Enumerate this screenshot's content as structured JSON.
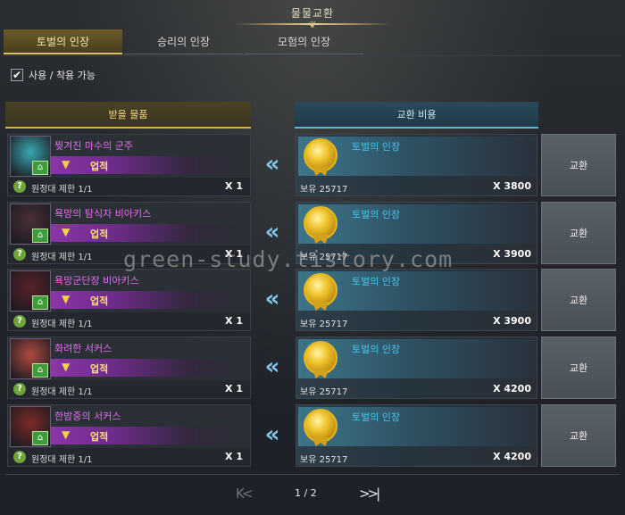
{
  "title": "물물교환",
  "tabs": [
    {
      "label": "토벌의 인장",
      "active": true
    },
    {
      "label": "승리의 인장",
      "active": false
    },
    {
      "label": "모험의 인장",
      "active": false
    }
  ],
  "filter": {
    "checked": true,
    "label": "사용 / 착용 가능"
  },
  "columns": {
    "receive": "받을 물품",
    "cost": "교환 비용"
  },
  "rows": [
    {
      "item_name": "찢겨진 마수의 군주",
      "tag": "업적",
      "limit": "원정대 제한 1/1",
      "qty": "X 1",
      "cost_name": "토벌의 인장",
      "owned": "보유 25717",
      "cost_qty": "X 3800",
      "button": "교환",
      "thumb_color": "#3aa6b0"
    },
    {
      "item_name": "욕망의 탐식자 비아키스",
      "tag": "업적",
      "limit": "원정대 제한 1/1",
      "qty": "X 1",
      "cost_name": "토벌의 인장",
      "owned": "보유 25717",
      "cost_qty": "X 3900",
      "button": "교환",
      "thumb_color": "#4a3038"
    },
    {
      "item_name": "욕망군단장 비아키스",
      "tag": "업적",
      "limit": "원정대 제한 1/1",
      "qty": "X 1",
      "cost_name": "토벌의 인장",
      "owned": "보유 25717",
      "cost_qty": "X 3900",
      "button": "교환",
      "thumb_color": "#5a2228"
    },
    {
      "item_name": "화려한 서커스",
      "tag": "업적",
      "limit": "원정대 제한 1/1",
      "qty": "X 1",
      "cost_name": "토벌의 인장",
      "owned": "보유 25717",
      "cost_qty": "X 4200",
      "button": "교환",
      "thumb_color": "#b04a40"
    },
    {
      "item_name": "한밤중의 서커스",
      "tag": "업적",
      "limit": "원정대 제한 1/1",
      "qty": "X 1",
      "cost_name": "토벌의 인장",
      "owned": "보유 25717",
      "cost_qty": "X 4200",
      "button": "교환",
      "thumb_color": "#7a2a26"
    }
  ],
  "pager": {
    "first": "K<",
    "page": "1 / 2",
    "last": ">>|"
  },
  "watermark": "green-study.tistory.com",
  "icons": {
    "check": "✔",
    "home": "⌂",
    "question": "?",
    "arrow": "«",
    "tag": "▼"
  }
}
